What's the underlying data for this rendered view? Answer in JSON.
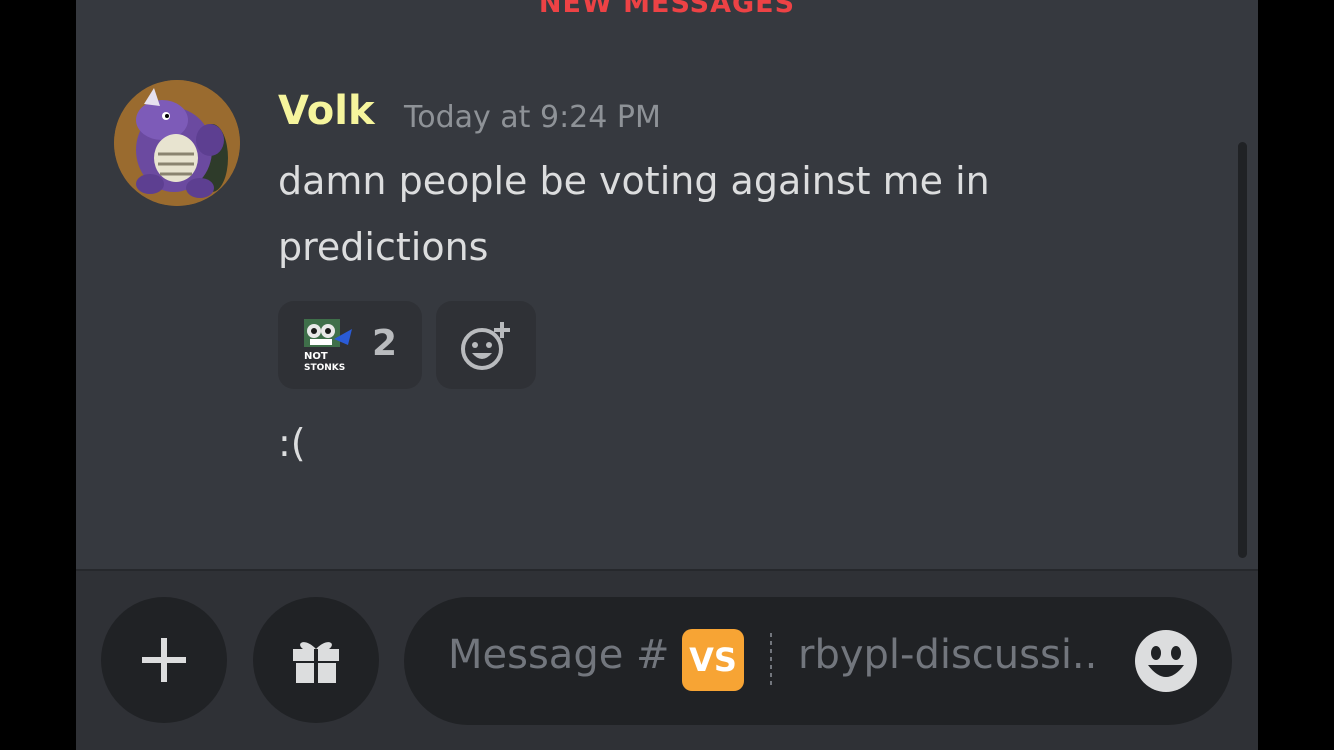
{
  "banner": {
    "new_messages": "NEW MESSAGES"
  },
  "message": {
    "username": "Volk",
    "timestamp": "Today at 9:24 PM",
    "text": "damn people be voting against me in predictions",
    "reactions": [
      {
        "emoji_icon": "not-stonks-emoji-icon",
        "emoji_caption": "NOT STONKS",
        "count": "2"
      }
    ],
    "add_reaction_icon": "add-reaction-icon",
    "followup_text": ":("
  },
  "composer": {
    "placeholder_prefix": "Message #",
    "channel_badge": "VS",
    "channel_name": "rbypl-discussi..",
    "plus_icon": "plus-icon",
    "gift_icon": "gift-icon",
    "emoji_icon": "smiley-emoji-icon"
  },
  "colors": {
    "background": "#36393f",
    "username": "#f6f59d",
    "new_messages": "#ed4245",
    "badge": "#f7a434"
  }
}
